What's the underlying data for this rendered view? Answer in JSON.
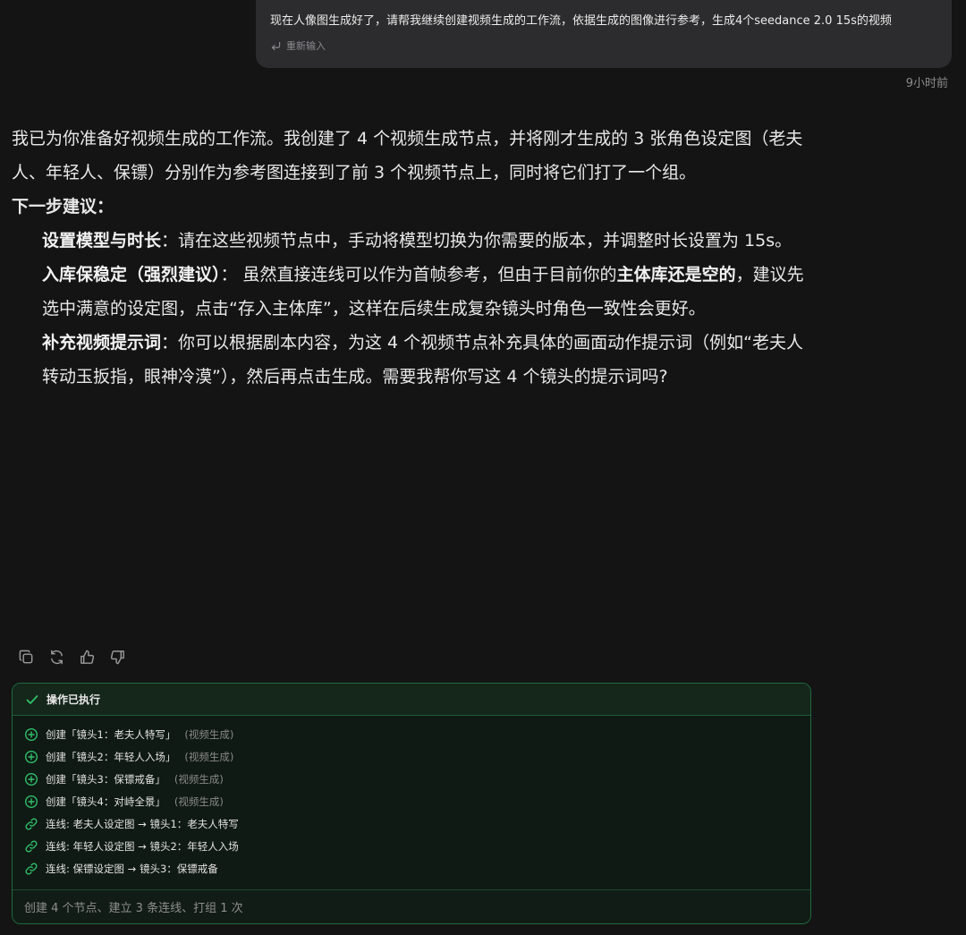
{
  "user_message": {
    "text": "现在人像图生成好了，请帮我继续创建视频生成的工作流，依据生成的图像进行参考，生成4个seedance 2.0 15s的视频",
    "reinput_label": "重新输入",
    "timestamp": "9小时前"
  },
  "reply": {
    "intro": "我已为你准备好视频生成的工作流。我创建了 4 个视频生成节点，并将刚才生成的 3 张角色设定图（老夫人、年轻人、保镖）分别作为参考图连接到了前 3 个视频节点上，同时将它们打了一个组。",
    "next_title": "下一步建议：",
    "items": [
      {
        "bold": "设置模型与时长",
        "text": "：请在这些视频节点中，手动将模型切换为你需要的版本，并调整时长设置为 15s。"
      },
      {
        "bold": "入库保稳定（强烈建议）",
        "text_a": "： 虽然直接连线可以作为首帧参考，但由于目前你的",
        "bold_b": "主体库还是空的",
        "text_b": "，建议先选中满意的设定图，点击“存入主体库”，这样在后续生成复杂镜头时角色一致性会更好。"
      },
      {
        "bold": "补充视频提示词",
        "text": "：你可以根据剧本内容，为这 4 个视频节点补充具体的画面动作提示词（例如“老夫人转动玉扳指，眼神冷漠”），然后再点击生成。需要我帮你写这 4 个镜头的提示词吗?"
      }
    ]
  },
  "actions": [
    "copy-icon",
    "regenerate-icon",
    "thumbs-up-icon",
    "thumbs-down-icon"
  ],
  "panel": {
    "title": "操作已执行",
    "rows": [
      {
        "icon": "plus-circle-icon",
        "text": "创建「镜头1：老夫人特写」",
        "tag": "(视频生成)"
      },
      {
        "icon": "plus-circle-icon",
        "text": "创建「镜头2：年轻人入场」",
        "tag": "(视频生成)"
      },
      {
        "icon": "plus-circle-icon",
        "text": "创建「镜头3：保镖戒备」",
        "tag": "(视频生成)"
      },
      {
        "icon": "plus-circle-icon",
        "text": "创建「镜头4：对峙全景」",
        "tag": "(视频生成)"
      },
      {
        "icon": "link-icon",
        "text": "连线: 老夫人设定图 → 镜头1：老夫人特写",
        "tag": ""
      },
      {
        "icon": "link-icon",
        "text": "连线: 年轻人设定图 → 镜头2：年轻人入场",
        "tag": ""
      },
      {
        "icon": "link-icon",
        "text": "连线: 保镖设定图 → 镜头3：保镖戒备",
        "tag": ""
      }
    ],
    "footer": "创建 4 个节点、建立 3 条连线、打组 1 次"
  },
  "colors": {
    "accent_green": "#2fbf6a",
    "background": "#141414",
    "bubble": "#2c2c2e"
  }
}
